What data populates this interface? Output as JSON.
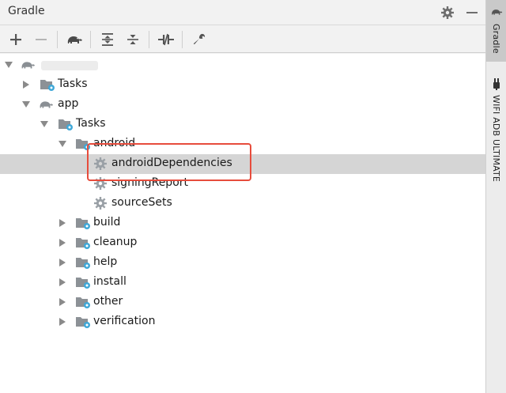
{
  "panel": {
    "title": "Gradle",
    "settings_icon": "gear-icon",
    "minimize_icon": "minimize-icon"
  },
  "toolbar": {
    "buttons": [
      {
        "name": "add",
        "icon": "plus-icon"
      },
      {
        "name": "remove",
        "icon": "minus-icon"
      },
      {
        "name": "run-gradle-task",
        "icon": "elephant-icon"
      },
      {
        "name": "expand-all",
        "icon": "expand-all-icon"
      },
      {
        "name": "collapse-all",
        "icon": "collapse-all-icon"
      },
      {
        "name": "toggle-offline-mode",
        "icon": "offline-icon"
      },
      {
        "name": "gradle-settings",
        "icon": "wrench-icon"
      }
    ]
  },
  "tree": {
    "root_label": "",
    "nodes": {
      "root_tasks": "Tasks",
      "app": "app",
      "app_tasks": "Tasks",
      "android": "android",
      "androidDependencies": "androidDependencies",
      "signingReport": "signingReport",
      "sourceSets": "sourceSets",
      "build": "build",
      "cleanup": "cleanup",
      "help": "help",
      "install": "install",
      "other": "other",
      "verification": "verification"
    },
    "selected": "androidDependencies"
  },
  "sidebar": {
    "tabs": [
      {
        "label": "Gradle",
        "icon": "elephant-icon",
        "active": true
      },
      {
        "label": "WIFI ADB ULTIMATE",
        "icon": "android-plug-icon",
        "active": false
      }
    ]
  },
  "colors": {
    "selection": "#d5d5d5",
    "highlight_box": "#e74c3c",
    "folder_blue": "#3fa8d8"
  }
}
